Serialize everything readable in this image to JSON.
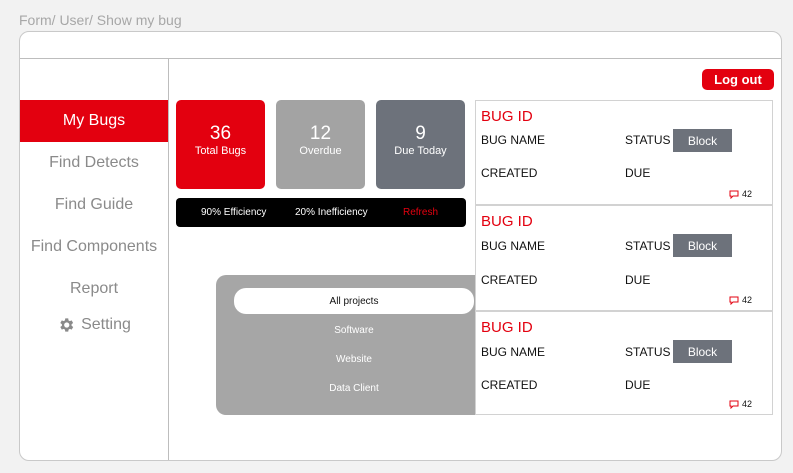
{
  "breadcrumb": "Form/ User/ Show my bug",
  "sidebar": {
    "items": [
      {
        "label": "My Bugs"
      },
      {
        "label": "Find Detects"
      },
      {
        "label": "Find Guide"
      },
      {
        "label": "Find Components"
      },
      {
        "label": "Report"
      },
      {
        "label": "Setting",
        "icon": "gear-icon"
      }
    ]
  },
  "header": {
    "logout_label": "Log out"
  },
  "stats": [
    {
      "value": "36",
      "label": "Total Bugs",
      "color": "#e3000f"
    },
    {
      "value": "12",
      "label": "Overdue",
      "color": "#a3a3a3"
    },
    {
      "value": "9",
      "label": "Due Today",
      "color": "#6d727b"
    }
  ],
  "efficiency": {
    "efficiency": "90% Efficiency",
    "inefficiency": "20% Inefficiency",
    "refresh": "Refresh"
  },
  "projects": {
    "selected": "All projects",
    "options": [
      "Software",
      "Website",
      "Data Client"
    ]
  },
  "bugs": [
    {
      "id_label": "BUG ID",
      "name_label": "BUG NAME",
      "status_label": "STATUS",
      "status_value": "Block",
      "created_label": "CREATED",
      "due_label": "DUE",
      "comments": "42"
    },
    {
      "id_label": "BUG ID",
      "name_label": "BUG NAME",
      "status_label": "STATUS",
      "status_value": "Block",
      "created_label": "CREATED",
      "due_label": "DUE",
      "comments": "42"
    },
    {
      "id_label": "BUG ID",
      "name_label": "BUG NAME",
      "status_label": "STATUS",
      "status_value": "Block",
      "created_label": "CREATED",
      "due_label": "DUE",
      "comments": "42"
    }
  ],
  "colors": {
    "accent": "#e3000f",
    "block": "#6d727b",
    "panel": "#a6a6a6"
  }
}
